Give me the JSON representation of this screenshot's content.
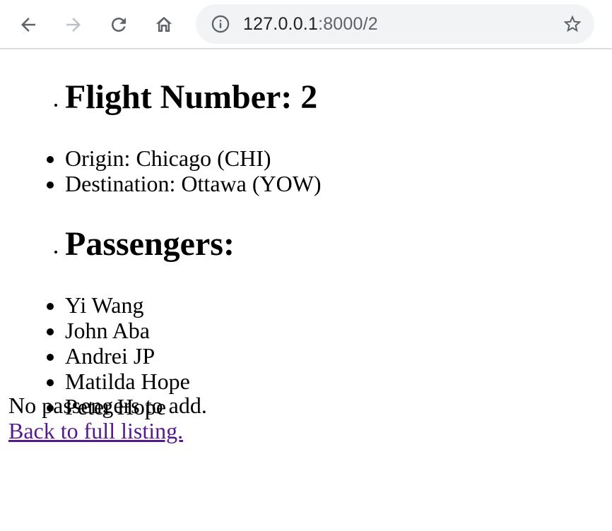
{
  "browser": {
    "url_host": "127.0.0.1",
    "url_path": ":8000/2",
    "icons": {
      "back": "back-arrow-icon",
      "forward": "forward-arrow-icon",
      "reload": "reload-icon",
      "home": "home-icon",
      "info": "info-icon",
      "bookmark": "star-icon"
    }
  },
  "flight": {
    "heading": "Flight Number: 2",
    "details": [
      "Origin: Chicago (CHI)",
      "Destination: Ottawa (YOW)"
    ]
  },
  "passengers": {
    "heading": "Passengers:",
    "names": [
      "Yi Wang",
      "John Aba",
      "Andrei JP",
      "Matilda Hope",
      "Peter Hope"
    ]
  },
  "footer": {
    "no_passengers_text": "No passengers to add.",
    "back_link_text": "Back to full listing."
  },
  "colors": {
    "link_visited": "#551a8b",
    "omnibox_bg": "#f1f3f4",
    "icon_gray": "#5f6368",
    "icon_disabled": "#bdc1c6"
  }
}
